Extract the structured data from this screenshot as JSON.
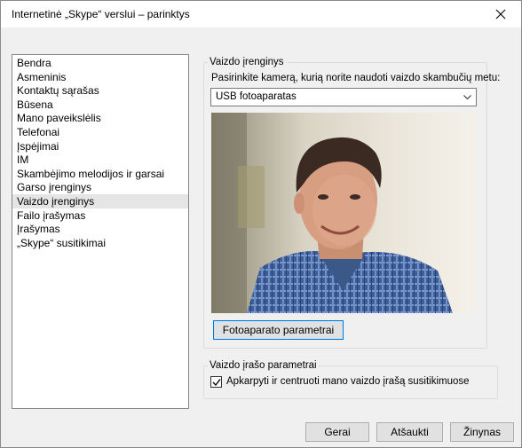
{
  "window": {
    "title": "Internetinė „Skype“ verslui – parinktys",
    "close_icon": "close-icon"
  },
  "sidebar": {
    "items": [
      {
        "label": "Bendra",
        "selected": false
      },
      {
        "label": "Asmeninis",
        "selected": false
      },
      {
        "label": "Kontaktų sąrašas",
        "selected": false
      },
      {
        "label": "Būsena",
        "selected": false
      },
      {
        "label": "Mano paveikslėlis",
        "selected": false
      },
      {
        "label": "Telefonai",
        "selected": false
      },
      {
        "label": "Įspėjimai",
        "selected": false
      },
      {
        "label": "IM",
        "selected": false
      },
      {
        "label": "Skambėjimo melodijos ir garsai",
        "selected": false
      },
      {
        "label": "Garso įrenginys",
        "selected": false
      },
      {
        "label": "Vaizdo įrenginys",
        "selected": true
      },
      {
        "label": "Failo įrašymas",
        "selected": false
      },
      {
        "label": "Įrašymas",
        "selected": false
      },
      {
        "label": "„Skype“ susitikimai",
        "selected": false
      }
    ]
  },
  "video_device": {
    "legend": "Vaizdo įrenginys",
    "prompt": "Pasirinkite kamerą, kurią norite naudoti vaizdo skambučių metu:",
    "selected_camera": "USB fotoaparatas",
    "camera_settings_button": "Fotoaparato parametrai"
  },
  "video_recording": {
    "legend": "Vaizdo įrašo parametrai",
    "crop_center_label": "Apkarpyti ir centruoti mano vaizdo įrašą susitikimuose",
    "crop_center_checked": true
  },
  "footer": {
    "ok": "Gerai",
    "cancel": "Atšaukti",
    "help": "Žinynas"
  },
  "colors": {
    "window_bg": "#f0f0f0",
    "selected_item_bg": "#e5e5e5",
    "focus_border": "#0078d7"
  }
}
